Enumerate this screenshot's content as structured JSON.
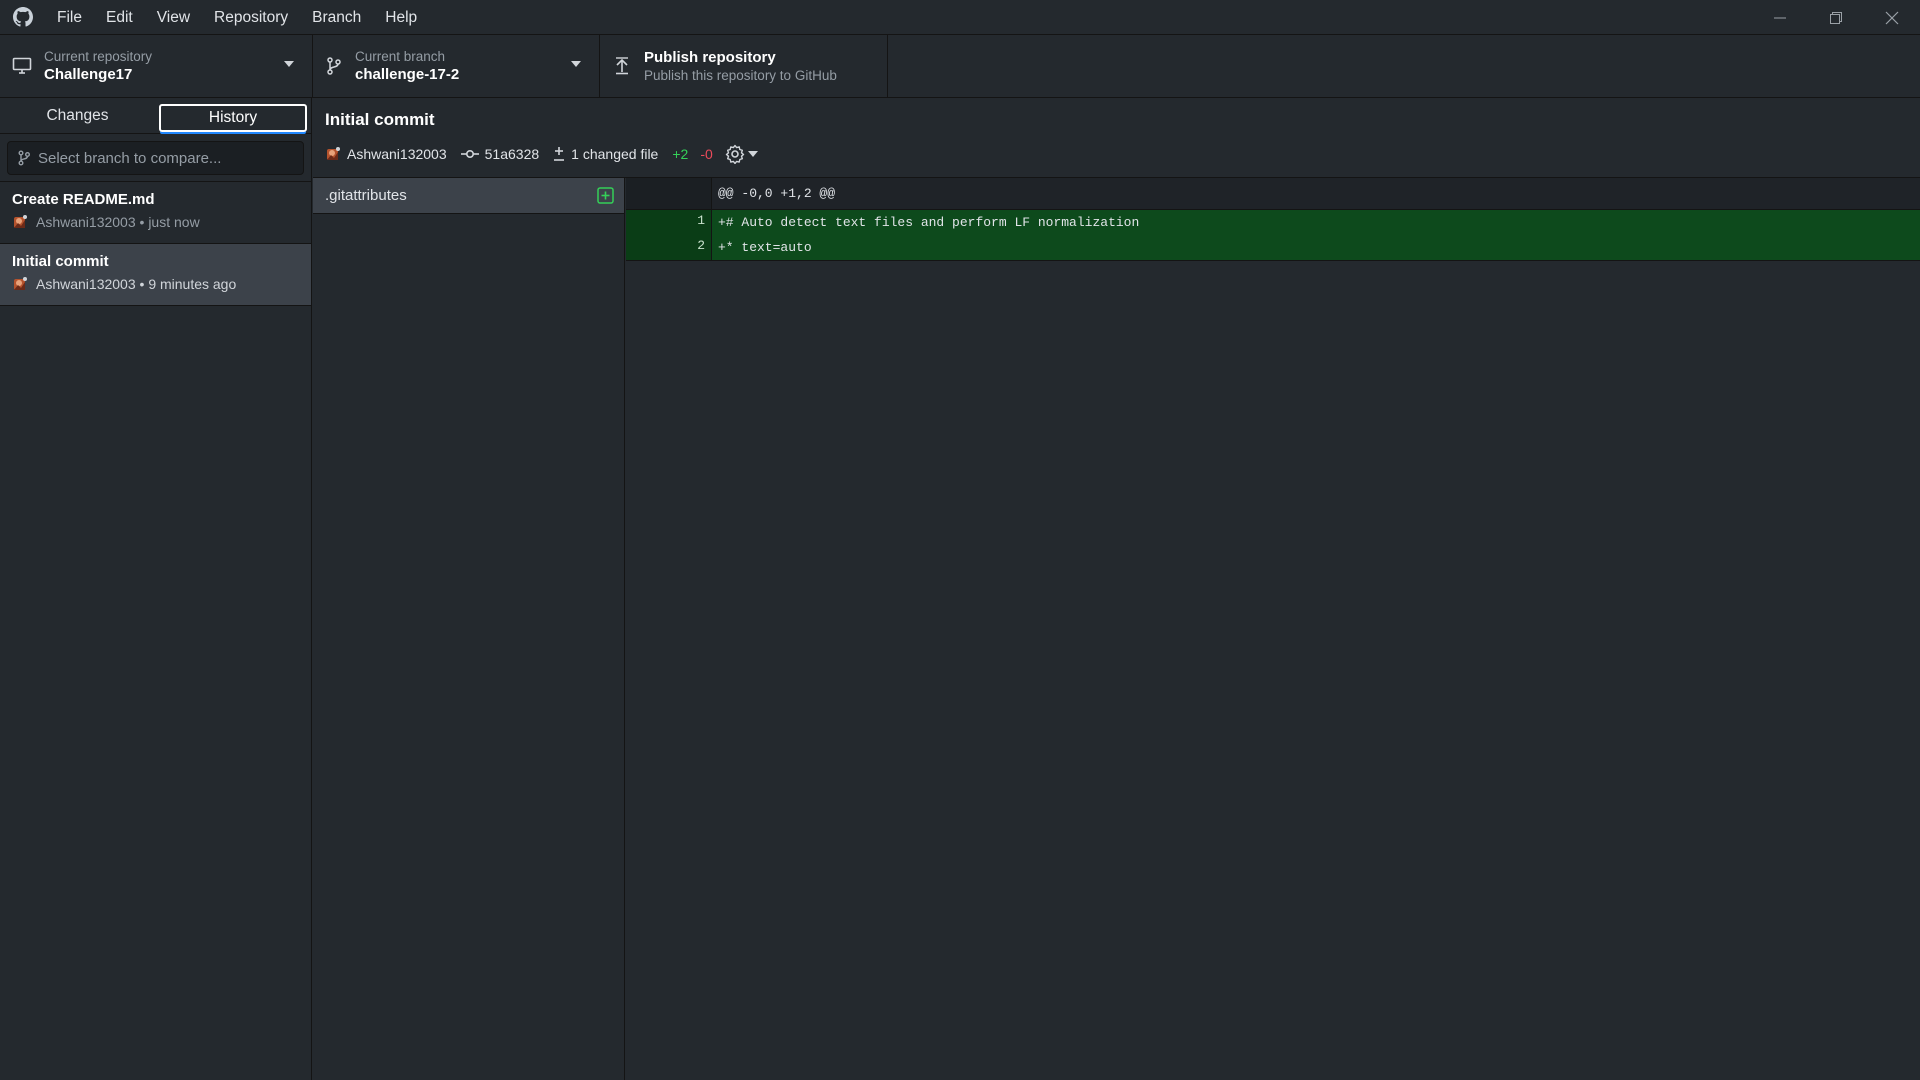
{
  "menu": {
    "items": [
      "File",
      "Edit",
      "View",
      "Repository",
      "Branch",
      "Help"
    ]
  },
  "toolbar": {
    "repository": {
      "label": "Current repository",
      "value": "Challenge17"
    },
    "branch": {
      "label": "Current branch",
      "value": "challenge-17-2"
    },
    "publish": {
      "title": "Publish repository",
      "subtitle": "Publish this repository to GitHub"
    }
  },
  "sidebar": {
    "tabs": [
      "Changes",
      "History"
    ],
    "active_tab": "History",
    "compare_placeholder": "Select branch to compare...",
    "commits": [
      {
        "title": "Create README.md",
        "meta": "Ashwani132003 • just now"
      },
      {
        "title": "Initial commit",
        "meta": "Ashwani132003 • 9 minutes ago"
      }
    ]
  },
  "commit": {
    "title": "Initial commit",
    "author": "Ashwani132003",
    "sha": "51a6328",
    "changed_files": "1 changed file",
    "additions": "+2",
    "deletions": "-0"
  },
  "files": [
    {
      "name": ".gitattributes",
      "status": "added"
    }
  ],
  "diff": {
    "hunk_header": "@@ -0,0 +1,2 @@",
    "lines": [
      {
        "num": "1",
        "text": "+# Auto detect text files and perform LF normalization"
      },
      {
        "num": "2",
        "text": "+* text=auto"
      }
    ]
  },
  "colors": {
    "background": "#24292e",
    "addition_bg": "#0d4a1c",
    "addition_text": "#34d058",
    "deletion_text": "#ea4a5a",
    "accent": "#2188ff"
  }
}
